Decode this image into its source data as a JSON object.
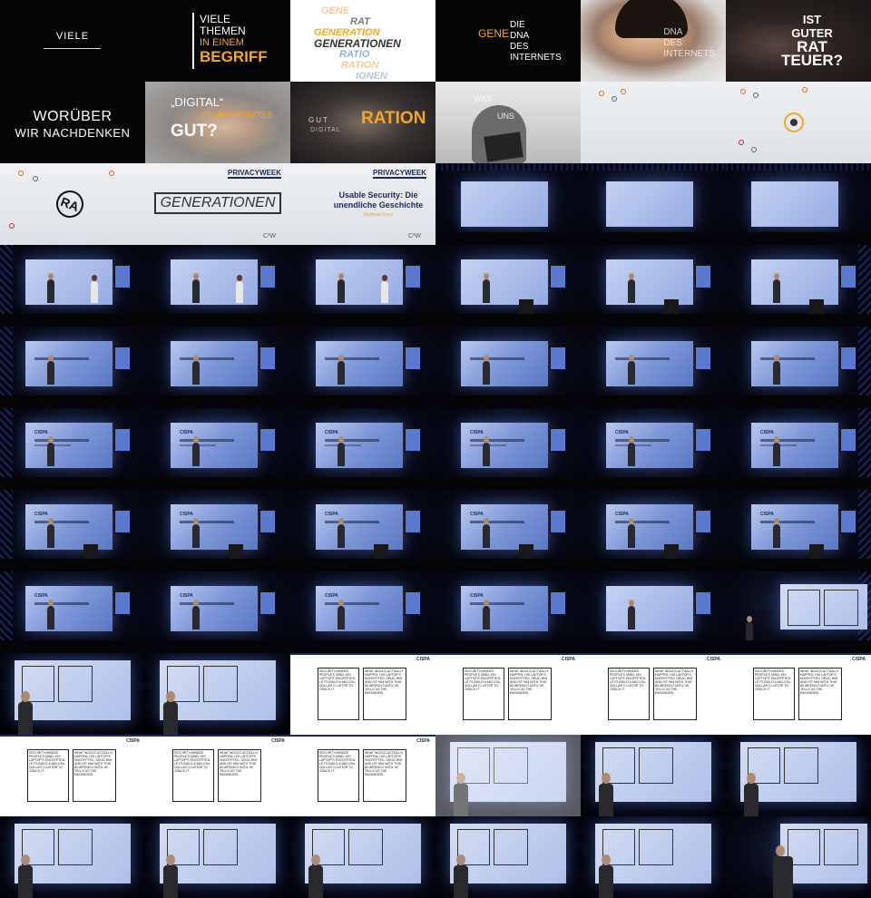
{
  "grid": {
    "columns": 6,
    "rows": 11
  },
  "intro": {
    "viele": "VIELE",
    "themen": {
      "line1": "VIELE",
      "line2": "THEMEN",
      "line3": "IN EINEM",
      "line4": "BEGRIFF"
    },
    "gene_stack": [
      "GENE",
      "RAT",
      "GENERATION",
      "GENERATIONEN",
      "RATIO",
      "RATION",
      "IONEN"
    ],
    "dna": {
      "gene": "GENE",
      "line1": "DIE",
      "line2": "DNA",
      "line3": "DES",
      "line4": "INTERNETS"
    },
    "face_overlay": {
      "line1": "DNA",
      "line2": "DES",
      "line3": "INTERNETS"
    },
    "rat": {
      "line1": "IST",
      "line2": "GUTER",
      "line3": "RAT",
      "line4": "TEUER?"
    },
    "woruber": {
      "line1": "WORÜBER",
      "line2": "WIR NACHDENKEN"
    },
    "digital": {
      "line1": "„DIGITAL“",
      "line2": "EIN BEGRENZTES",
      "line3": "GUT?"
    },
    "ration": {
      "word": "RATION",
      "small": "GUT",
      "small2": "DIGITAL"
    },
    "tablet": {
      "line1": "WAS",
      "line2": "UNS"
    },
    "privacyweek": "PRIVACYWEEK",
    "generationen_box": "GENERATIONEN",
    "cw_mark": "C³W",
    "ra_logo": "RA",
    "talk_title": "Usable Security: Die unendliche Geschichte",
    "talk_speaker": "Matthias Fassl"
  },
  "stage": {
    "slide_logo": "CISPA",
    "comic_brand": "CISPA"
  },
  "comic": {
    "left_caption": "SECURITY-MINDED PEOPLE'S MIND: HIS LAPTOP'S ENCRYPTED. LET'S BUILD A MILLION-DOLLAR CLUSTER TO CRACK IT.",
    "right_caption": "WHAT WOULD ACTUALLY HAPPEN: HIS LAPTOP'S ENCRYPTED. DRUG HIM AND HIT HIM WITH THIS $5 WRENCH UNTIL HE TELLS US THE PASSWORD."
  },
  "colors": {
    "accent": "#f5a623",
    "navy": "#1d2a55",
    "stage_blue": "#5a78c4"
  }
}
